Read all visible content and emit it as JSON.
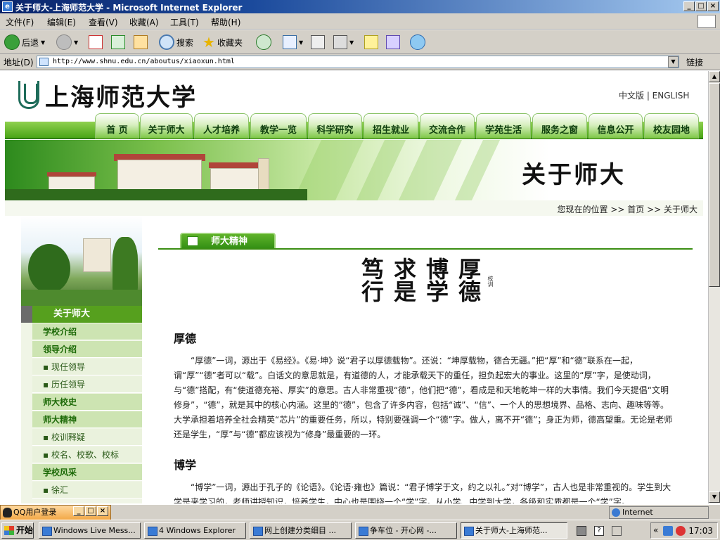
{
  "window": {
    "title": "关于师大-上海师范大学 - Microsoft Internet Explorer",
    "min": "_",
    "max": "□",
    "close": "×"
  },
  "menu": [
    "文件(F)",
    "编辑(E)",
    "查看(V)",
    "收藏(A)",
    "工具(T)",
    "帮助(H)"
  ],
  "toolbar": {
    "back": "后退",
    "search": "搜索",
    "favorites": "收藏夹"
  },
  "address": {
    "label": "地址(D)",
    "url": "http://www.shnu.edu.cn/aboutus/xiaoxun.html",
    "links": "链接"
  },
  "site": {
    "logo_text": "上海师范大学",
    "lang": "中文版 | ENGLISH",
    "nav": [
      "首 页",
      "关于师大",
      "人才培养",
      "教学一览",
      "科学研究",
      "招生就业",
      "交流合作",
      "学苑生活",
      "服务之窗",
      "信息公开",
      "校友园地"
    ],
    "banner_title": "关于师大",
    "breadcrumb": "您现在的位置 >> 首页 >> 关于师大",
    "sidebar_title": "关于师大",
    "sidebar": [
      {
        "label": "学校介绍",
        "level": 1
      },
      {
        "label": "领导介绍",
        "level": 1
      },
      {
        "label": "▪ 现任领导",
        "level": 2
      },
      {
        "label": "▪ 历任领导",
        "level": 2
      },
      {
        "label": "师大校史",
        "level": 1
      },
      {
        "label": "师大精神",
        "level": 1
      },
      {
        "label": "▪ 校训释疑",
        "level": 2
      },
      {
        "label": "▪ 校名、校歌、校标",
        "level": 2
      },
      {
        "label": "学校风采",
        "level": 1
      },
      {
        "label": "▪ 徐汇",
        "level": 2
      }
    ],
    "tab_title": "师大精神",
    "motto": {
      "chars": [
        "厚德",
        "博学",
        "求是",
        "笃行"
      ],
      "label": "校训"
    },
    "sections": [
      {
        "heading": "厚德",
        "text": "“厚德”一词，源出于《易经》。《易·坤》说“君子以厚德载物”。还说：“坤厚载物，德合无疆。”把“厚”和“德”联系在一起，谓“厚”“德”者可以“载”。白话文的意思就是，有道德的人，才能承载天下的重任，担负起宏大的事业。这里的“厚”字，是使动词，与“德”搭配，有“使道德充裕、厚实”的意思。古人非常重视“德”，他们把“德”，看成是和天地乾坤一样的大事情。我们今天提倡“文明修身”，“德”，就是其中的核心内涵。这里的“德”，包含了许多内容，包括“诚”、“信”、一个人的思想境界、品格、志向、趣味等等。大学承担着培养全社会精英“芯片”的重要任务，所以，特别要强调一个“德”字。做人，离不开“德”；身正为师，德高望重。无论是老师还是学生，“厚”与“德”都应该视为“修身”最重要的一环。"
      },
      {
        "heading": "博学",
        "text": "“博学”一词，源出于孔子的《论语》。《论语·雍也》篇说：“君子博学于文，约之以礼。”对“博学”，古人也是非常重视的。学生到大学是来学习的，老师讲授知识，培养学生，中心也是围绕一个“学”字。从小学、中学到大学，各级和实质都是一个“学”字。"
      }
    ]
  },
  "status": {
    "qq": "QQ用户登录",
    "zone": "Internet"
  },
  "taskbar": {
    "start": "开始",
    "tasks": [
      "Windows Live Mess...",
      "4 Windows Explorer",
      "网上创建分类细目 ...",
      "争车位 - 开心网 -...",
      "关于师大-上海师范..."
    ],
    "clock": "17:03"
  }
}
